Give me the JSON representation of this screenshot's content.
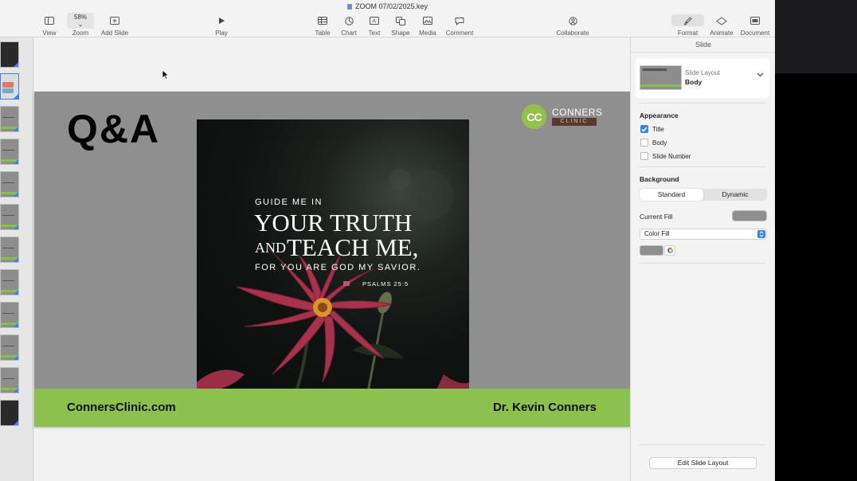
{
  "window": {
    "title": "ZOOM 07/02/2025.key"
  },
  "toolbar": {
    "view": "View",
    "zoom_value": "58%",
    "zoom": "Zoom",
    "add_slide": "Add Slide",
    "play": "Play",
    "table": "Table",
    "chart": "Chart",
    "text": "Text",
    "shape": "Shape",
    "media": "Media",
    "comment": "Comment",
    "collaborate": "Collaborate",
    "format": "Format",
    "animate": "Animate",
    "document": "Document"
  },
  "slide": {
    "title": "Q&A",
    "logo_initials": "CC",
    "logo_name": "CONNERS",
    "logo_sub": "CLINIC",
    "quote_line1": "GUIDE ME IN",
    "quote_line2": "YOUR TRUTH",
    "quote_and": "AND",
    "quote_line3": "TEACH ME,",
    "quote_line4": "FOR YOU ARE GOD MY SAVIOR.",
    "quote_ref": "PSALMS 25:5",
    "footer_left": "ConnersClinic.com",
    "footer_right": "Dr. Kevin Conners",
    "colors": {
      "slide_bg": "#8f8f8f",
      "footer_bar": "#8cc04f",
      "logo_green": "#93c24a",
      "logo_brown": "#5a3a2c"
    }
  },
  "inspector": {
    "header": "Slide",
    "layout_caption": "Slide Layout",
    "layout_value": "Body",
    "appearance": "Appearance",
    "checkboxes": [
      {
        "label": "Title",
        "checked": true
      },
      {
        "label": "Body",
        "checked": false
      },
      {
        "label": "Slide Number",
        "checked": false
      }
    ],
    "background": "Background",
    "segment": {
      "standard": "Standard",
      "dynamic": "Dynamic",
      "selected": "Standard"
    },
    "current_fill": "Current Fill",
    "fill_type": "Color Fill",
    "edit_layout": "Edit Slide Layout",
    "colors": {
      "accent": "#3c82e6",
      "fill_color": "#8f8f8f"
    }
  }
}
